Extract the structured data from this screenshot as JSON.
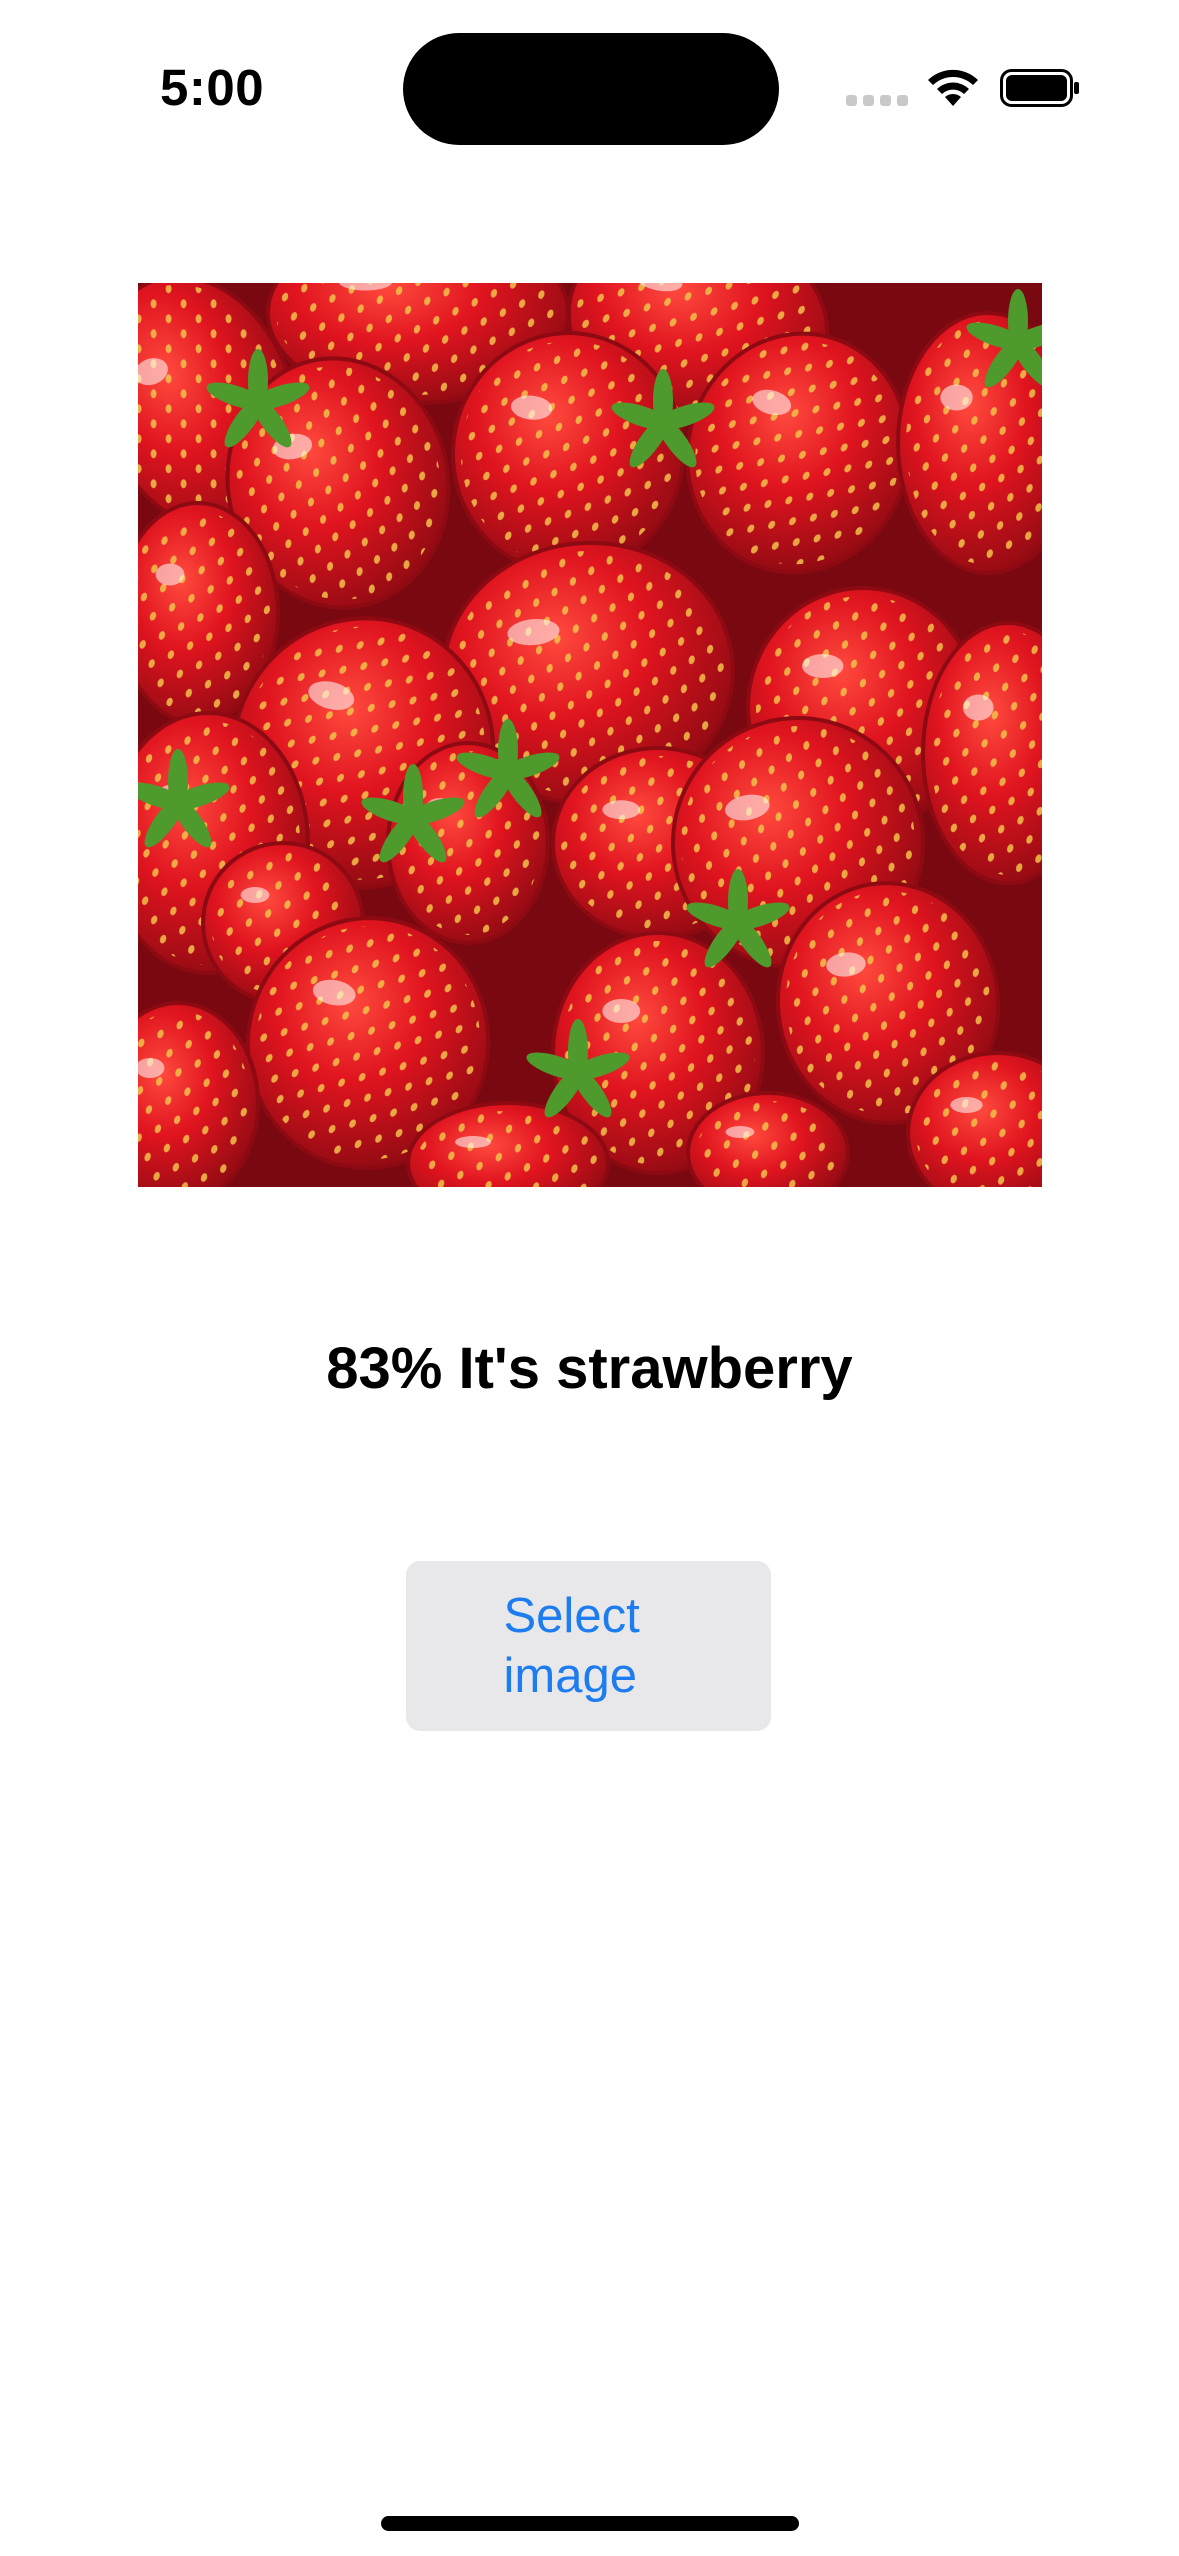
{
  "status_bar": {
    "time": "5:00",
    "icons": [
      "cellular-signal-icon",
      "wifi-icon",
      "battery-icon"
    ]
  },
  "photo": {
    "subject": "strawberries",
    "colors": {
      "berry": "#d3101b",
      "berry_dark": "#8e0a12",
      "seed": "#f2c24a",
      "leaf": "#4f9a2c",
      "highlight": "#ffffff"
    }
  },
  "result": {
    "text": "83% It's strawberry"
  },
  "select_button": {
    "label": "Select image",
    "color": "#1c7cf0",
    "background": "#e8e8ea"
  }
}
